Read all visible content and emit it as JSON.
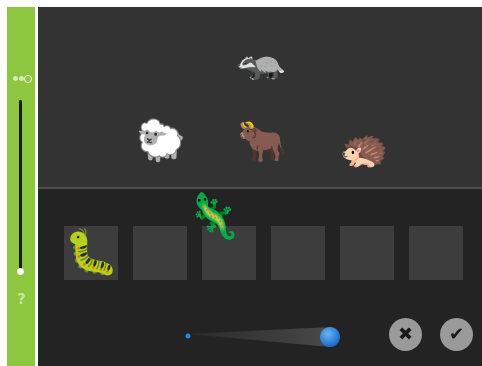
{
  "sidebar": {
    "help_label": "?",
    "level": {
      "value": 0.02
    },
    "icons": [
      "level-dots-icon",
      "help-icon"
    ]
  },
  "board": {
    "candidates": [
      {
        "name": "badger",
        "emoji": "🦡"
      },
      {
        "name": "sheep",
        "emoji": "🐑"
      },
      {
        "name": "ox",
        "emoji": "🐂"
      },
      {
        "name": "hedgehog",
        "emoji": "🦔"
      }
    ],
    "slots": [
      {
        "index": 1,
        "animal": "caterpillar",
        "emoji": "🐛"
      },
      {
        "index": 2,
        "animal": "",
        "emoji": ""
      },
      {
        "index": 3,
        "animal": "",
        "emoji": ""
      },
      {
        "index": 4,
        "animal": "",
        "emoji": ""
      },
      {
        "index": 5,
        "animal": "",
        "emoji": ""
      },
      {
        "index": 6,
        "animal": "",
        "emoji": ""
      }
    ],
    "dragging": {
      "animal": "lizard",
      "emoji": "🦎"
    }
  },
  "controls": {
    "cancel_symbol": "✖",
    "confirm_symbol": "✔",
    "size_ladder_icon": "size-ladder-icon"
  },
  "colors": {
    "sidebar": "#8dc63f",
    "board": "#232323",
    "animals_area": "#333333",
    "slot": "#3d3d3d",
    "ladder_dot": "#1e88e5",
    "button": "#9a9a9a"
  }
}
